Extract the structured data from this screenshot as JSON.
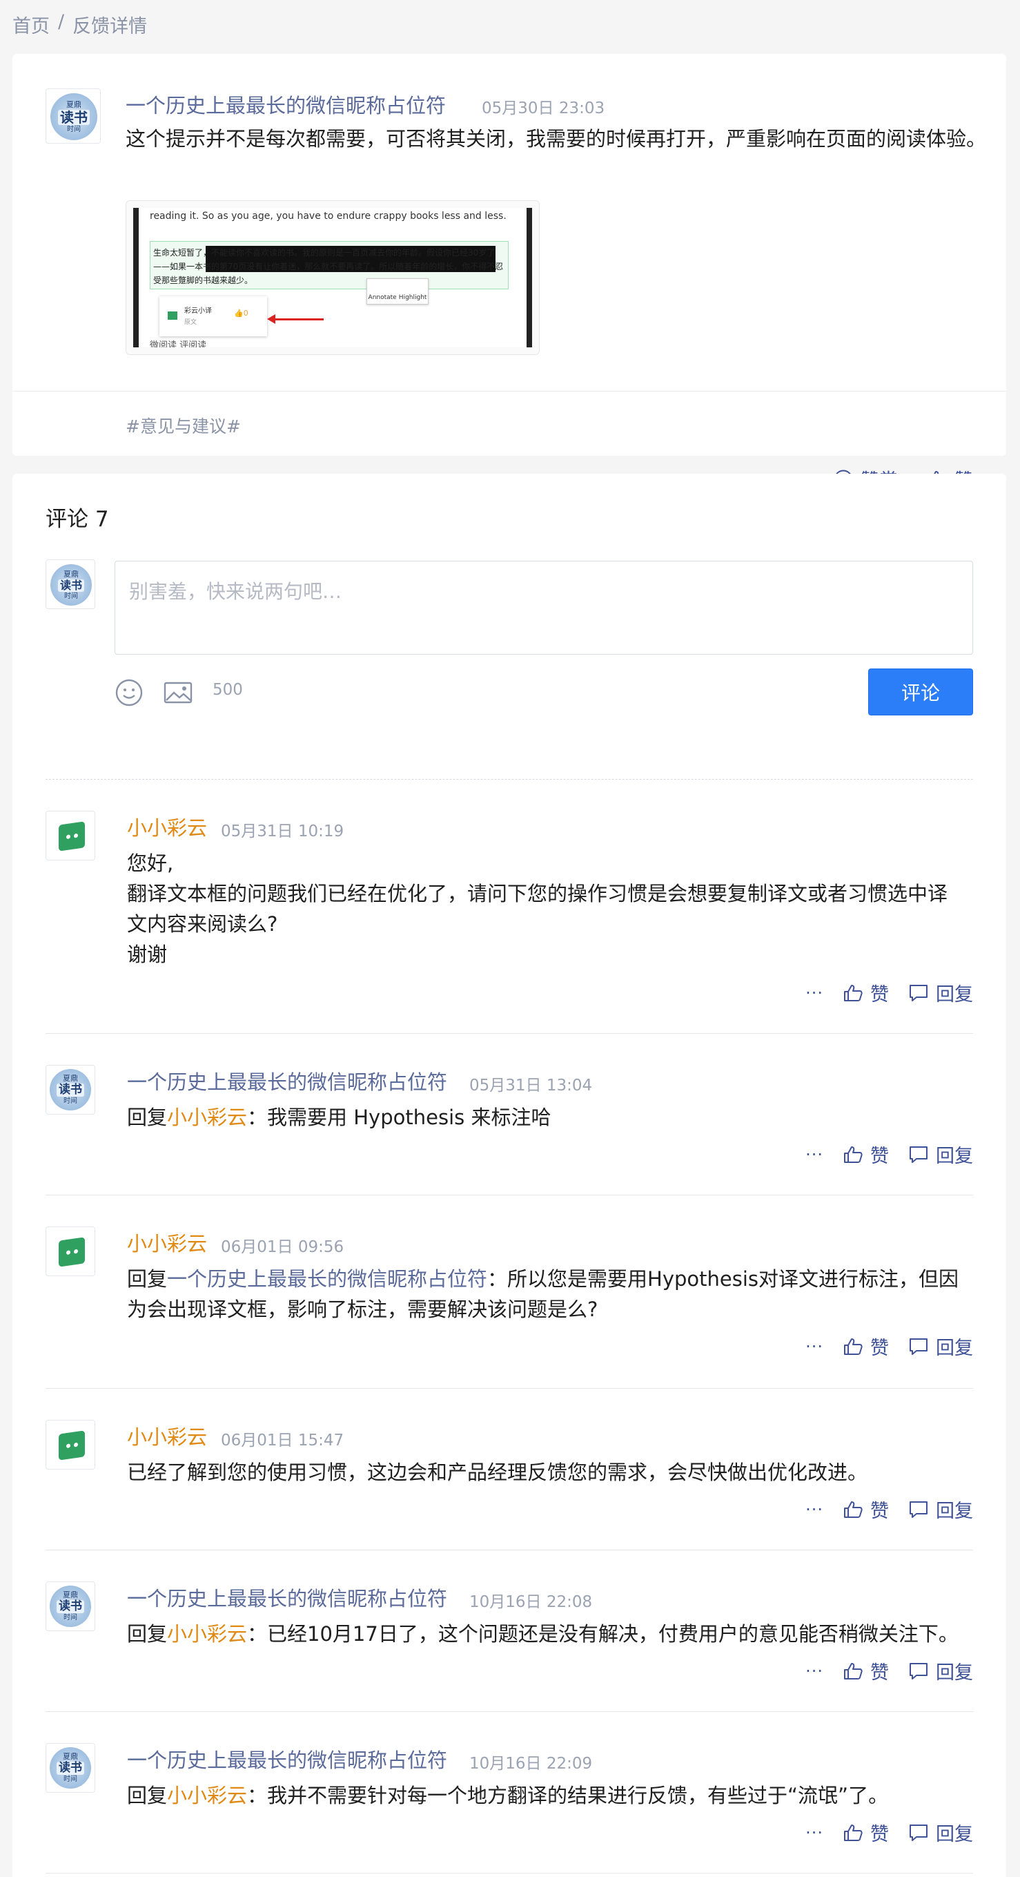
{
  "breadcrumb": {
    "home": "首页",
    "separator": "/",
    "current": "反馈详情"
  },
  "post": {
    "author": "一个历史上最最长的微信昵称占位符",
    "time": "05月30日 23:03",
    "body": "这个提示并不是每次都需要，可否将其关闭，我需要的时候再打开，严重影响在页面的阅读体验。",
    "image": {
      "line_top": "reading it. So as you age, you have to endure crappy books less and less.",
      "highlight_text": "生命太短暂了，不能读你不喜欢读的书。我的原则是一百页减去你的年龄。假设你已经30岁了——如果一本书的第70页没有让你着迷，那么就不要再读了。所以随着年龄的增长，你不得不忍受那些蹩脚的书越来越少。",
      "tooltip_annotate": "Annotate",
      "tooltip_highlight": "Highlight",
      "popup_name": "彩云小译",
      "popup_sub": "原文",
      "popup_like": "0",
      "line_bottom": "微阅读  评阅读"
    },
    "tag": "#意见与建议#",
    "more": "···",
    "reward_label": "赞赏",
    "like_label": "赞"
  },
  "composer": {
    "title": "评论 7",
    "placeholder": "别害羞，快来说两句吧…",
    "counter": "500",
    "submit_label": "评论"
  },
  "comments": [
    {
      "author": "小小彩云",
      "time": "05月31日 10:19",
      "lines": [
        "您好,",
        "翻译文本框的问题我们已经在优化了，请问下您的操作习惯是会想要复制译文或者习惯选中译",
        "文内容来阅读么?",
        "谢谢"
      ]
    },
    {
      "author": "一个历史上最最长的微信昵称占位符",
      "time": "05月31日 13:04",
      "reply_prefix": "回复",
      "reply_to": "小小彩云",
      "text": "：我需要用 Hypothesis 来标注哈"
    },
    {
      "author": "小小彩云",
      "time": "06月01日 09:56",
      "reply_prefix": "回复",
      "reply_to": "一个历史上最最长的微信昵称占位符",
      "text": "：所以您是需要用Hypothesis对译文进行标注，但因为会出现译文框，影响了标注，需要解决该问题是么?"
    },
    {
      "author": "小小彩云",
      "time": "06月01日 15:47",
      "text": "已经了解到您的使用习惯，这边会和产品经理反馈您的需求，会尽快做出优化改进。"
    },
    {
      "author": "一个历史上最最长的微信昵称占位符",
      "time": "10月16日 22:08",
      "reply_prefix": "回复",
      "reply_to": "小小彩云",
      "text": "：已经10月17日了，这个问题还是没有解决，付费用户的意见能否稍微关注下。"
    },
    {
      "author": "一个历史上最最长的微信昵称占位符",
      "time": "10月16日 22:09",
      "reply_prefix": "回复",
      "reply_to": "小小彩云",
      "text": "：我并不需要针对每一个地方翻译的结果进行反馈，有些过于“流氓”了。"
    }
  ],
  "comment_actions": {
    "more": "···",
    "like": "赞",
    "reply": "回复"
  },
  "avatar_text": {
    "top": "夏鼎",
    "mid": "读书",
    "bottom": "时间"
  },
  "colors": {
    "accent": "#2b7ef8",
    "bot_name": "#e08a15",
    "user_name": "#5a6a9a",
    "action": "#3f5297",
    "bot_avatar": "#2fa05f"
  }
}
